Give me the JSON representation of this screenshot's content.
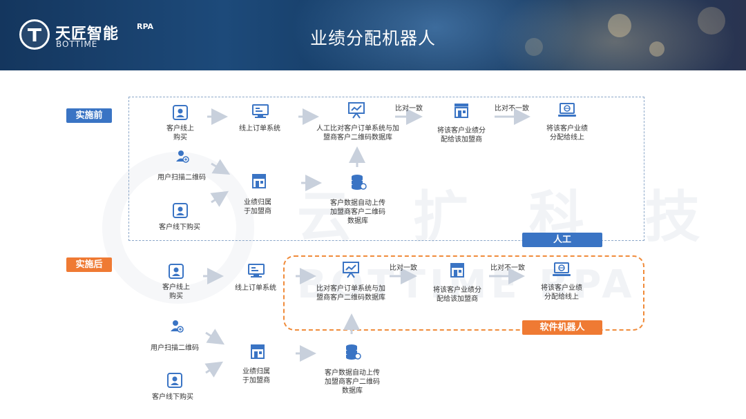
{
  "header": {
    "brand_cn": "天匠智能",
    "brand_rpa": "RPA",
    "brand_en": "BOTTIME",
    "title": "业绩分配机器人"
  },
  "watermark": {
    "text_cn": "云 扩 科 技",
    "text_en": "BOTTIME RPA"
  },
  "before": {
    "tag": "实施前",
    "footer_tag": "人工",
    "nodes": {
      "online_buy_1": "客户线上",
      "online_buy_2": "购买",
      "online_order": "线上订单系统",
      "manual_compare_1": "人工比对客户订单系统与加",
      "manual_compare_2": "盟商客户二维码数据库",
      "assign_franchise_1": "将该客户业绩分",
      "assign_franchise_2": "配给该加盟商",
      "assign_online_1": "将该客户业绩",
      "assign_online_2": "分配给线上",
      "scan_qr": "用户扫描二维码",
      "perf_belong_1": "业绩归属",
      "perf_belong_2": "于加盟商",
      "offline_buy": "客户线下购买",
      "auto_upload_1": "客户数据自动上传",
      "auto_upload_2": "加盟商客户二维码",
      "auto_upload_3": "数据库"
    },
    "edge_labels": {
      "match": "比对一致",
      "mismatch": "比对不一致"
    }
  },
  "after": {
    "tag": "实施后",
    "footer_tag": "软件机器人",
    "nodes": {
      "online_buy_1": "客户线上",
      "online_buy_2": "购买",
      "online_order": "线上订单系统",
      "compare_1": "比对客户订单系统与加",
      "compare_2": "盟商客户二维码数据库",
      "assign_franchise_1": "将该客户业绩分",
      "assign_franchise_2": "配给该加盟商",
      "assign_online_1": "将该客户业绩",
      "assign_online_2": "分配给线上",
      "scan_qr": "用户扫描二维码",
      "perf_belong_1": "业绩归属",
      "perf_belong_2": "于加盟商",
      "offline_buy": "客户线下购买",
      "auto_upload_1": "客户数据自动上传",
      "auto_upload_2": "加盟商客户二维码",
      "auto_upload_3": "数据库"
    },
    "edge_labels": {
      "match": "比对一致",
      "mismatch": "比对不一致"
    }
  },
  "colors": {
    "icon_blue": "#3a74c4",
    "tag_blue": "#3a74c4",
    "tag_orange": "#ef7a33",
    "arrow_gray": "#c8d0dc"
  }
}
